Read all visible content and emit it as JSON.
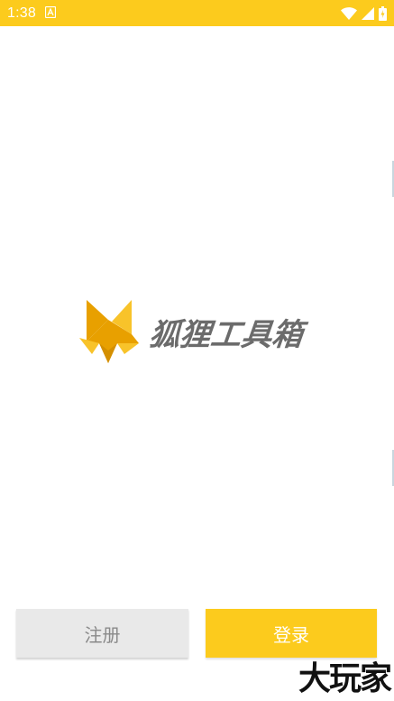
{
  "status_bar": {
    "time": "1:38",
    "icons": [
      "notification-a-icon",
      "wifi-icon",
      "cell-signal-icon",
      "battery-icon"
    ]
  },
  "logo": {
    "name": "狐狸工具箱",
    "icon": "fox-logo-icon",
    "text_color": "#6b6b6b"
  },
  "actions": {
    "register_label": "注册",
    "login_label": "登录"
  },
  "watermark": "大玩家",
  "colors": {
    "accent": "#fccb1d",
    "button_gray": "#e9e9e9",
    "fox_orange": "#e8a000",
    "fox_yellow": "#f8c32a"
  }
}
